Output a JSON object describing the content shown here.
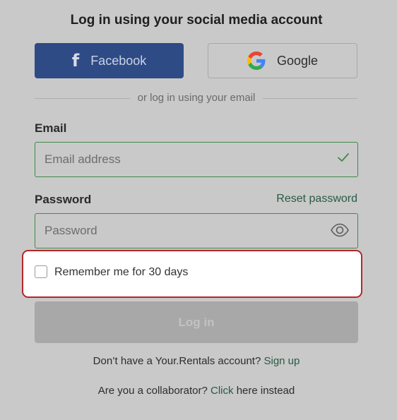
{
  "heading": "Log in using your social media account",
  "social": {
    "facebook_label": "Facebook",
    "facebook_icon": "f",
    "google_label": "Google"
  },
  "divider_text": "or log in using your email",
  "email": {
    "label": "Email",
    "placeholder": "Email address",
    "value": ""
  },
  "password": {
    "label": "Password",
    "placeholder": "Password",
    "value": "",
    "reset_link": "Reset password"
  },
  "remember": {
    "label": "Remember me for 30 days",
    "checked": false
  },
  "login_button": "Log in",
  "footer": {
    "signup_prefix": "Don’t have a Your.Rentals account?",
    "signup_link": "Sign up",
    "collab_prefix": "Are you a collaborator?",
    "collab_link": "Click",
    "collab_suffix": "here instead"
  },
  "colors": {
    "facebook": "#2f4b85",
    "link": "#2a5a45",
    "valid_border": "#3e8a4c",
    "highlight_border": "#b5252a",
    "disabled_button": "#a8a8a8"
  },
  "icons": [
    "facebook-icon",
    "google-icon",
    "check-icon",
    "eye-icon"
  ]
}
